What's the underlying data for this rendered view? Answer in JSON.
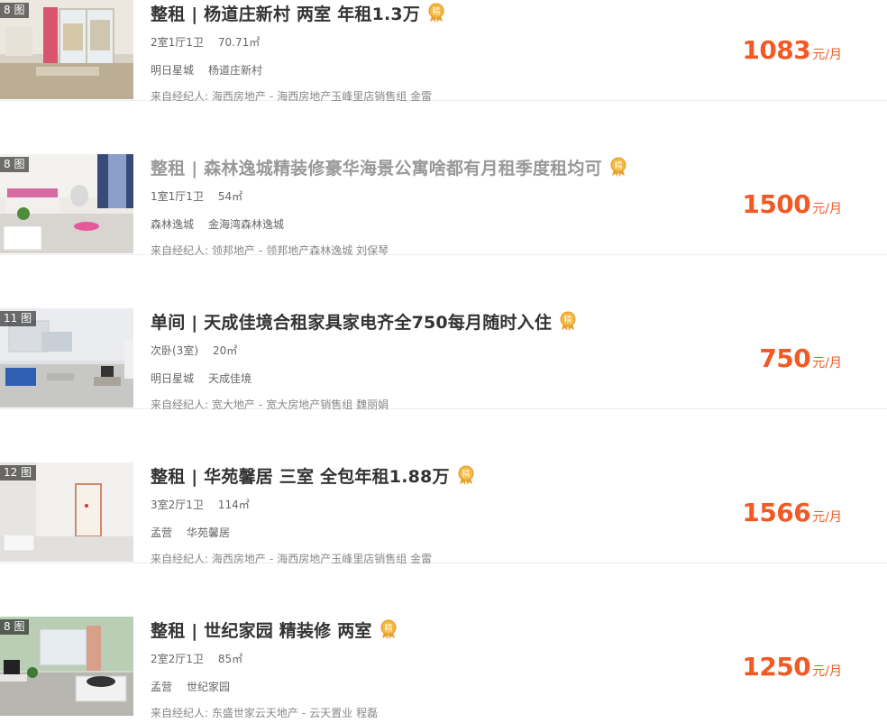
{
  "listings": [
    {
      "photo_count": "8 图",
      "title": "整租 | 杨道庄新村 两室 年租1.3万",
      "visited": false,
      "layout": "2室1厅1卫",
      "area": "70.71㎡",
      "district": "明日星城",
      "community": "杨道庄新村",
      "agent_prefix": "来自经纪人:",
      "agency": "海西房地产",
      "store": "海西房地产玉峰里店销售组",
      "agent_name": "金雷",
      "price": "1083",
      "price_unit": "元/月"
    },
    {
      "photo_count": "8 图",
      "title": "整租 | 森林逸城精装修豪华海景公寓啥都有月租季度租均可",
      "visited": true,
      "layout": "1室1厅1卫",
      "area": "54㎡",
      "district": "森林逸城",
      "community": "金海湾森林逸城",
      "agent_prefix": "来自经纪人:",
      "agency": "领邦地产",
      "store": "领邦地产森林逸城",
      "agent_name": "刘保琴",
      "price": "1500",
      "price_unit": "元/月"
    },
    {
      "photo_count": "11 图",
      "title": "单间 | 天成佳境合租家具家电齐全750每月随时入住",
      "visited": false,
      "layout": "次卧(3室)",
      "area": "20㎡",
      "district": "明日星城",
      "community": "天成佳境",
      "agent_prefix": "来自经纪人:",
      "agency": "宽大地产",
      "store": "宽大房地产销售组",
      "agent_name": "魏丽娟",
      "price": "750",
      "price_unit": "元/月"
    },
    {
      "photo_count": "12 图",
      "title": "整租 | 华苑馨居 三室 全包年租1.88万",
      "visited": false,
      "layout": "3室2厅1卫",
      "area": "114㎡",
      "district": "孟营",
      "community": "华苑馨居",
      "agent_prefix": "来自经纪人:",
      "agency": "海西房地产",
      "store": "海西房地产玉峰里店销售组",
      "agent_name": "金雷",
      "price": "1566",
      "price_unit": "元/月"
    },
    {
      "photo_count": "8 图",
      "title": "整租 | 世纪家园 精装修 两室",
      "visited": false,
      "layout": "2室2厅1卫",
      "area": "85㎡",
      "district": "孟营",
      "community": "世纪家园",
      "agent_prefix": "来自经纪人:",
      "agency": "东盛世家云天地产",
      "store": "云天置业",
      "agent_name": "程磊",
      "price": "1250",
      "price_unit": "元/月"
    }
  ],
  "badge": {
    "text": "精",
    "icon": "premium-medal-icon",
    "color": "#f5a623"
  },
  "colors": {
    "price": "#f15a24",
    "visited_title": "#999999",
    "title": "#333333"
  }
}
